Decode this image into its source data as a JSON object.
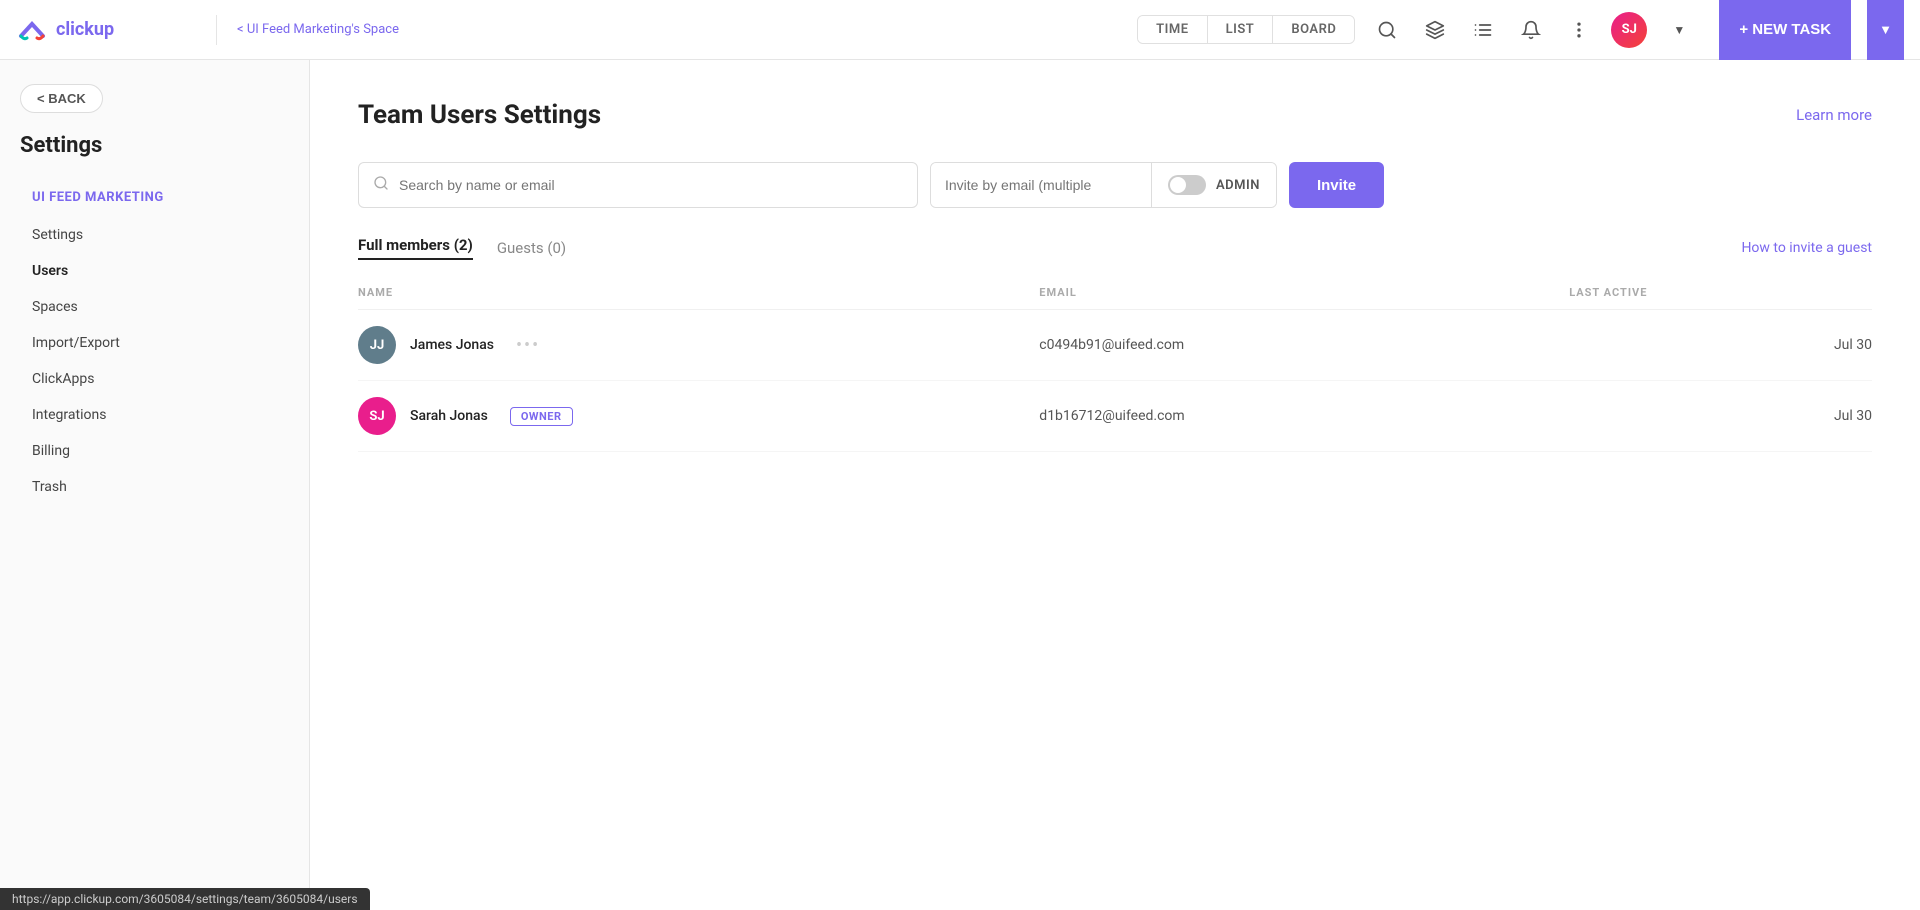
{
  "topnav": {
    "logo_text": "clickup",
    "breadcrumb_back": "< UI Feed Marketing's Space",
    "tabs": [
      {
        "label": "TIME",
        "id": "time"
      },
      {
        "label": "LIST",
        "id": "list"
      },
      {
        "label": "BOARD",
        "id": "board"
      }
    ],
    "new_task_label": "+ NEW TASK",
    "avatar_initials": "SJ"
  },
  "sidebar": {
    "back_label": "< BACK",
    "heading": "Settings",
    "active_item": "UI FEED MARKETING",
    "nav_items": [
      {
        "label": "Settings",
        "id": "settings"
      },
      {
        "label": "Users",
        "id": "users"
      },
      {
        "label": "Spaces",
        "id": "spaces"
      },
      {
        "label": "Import/Export",
        "id": "import-export"
      },
      {
        "label": "ClickApps",
        "id": "clickapps"
      },
      {
        "label": "Integrations",
        "id": "integrations"
      },
      {
        "label": "Billing",
        "id": "billing"
      },
      {
        "label": "Trash",
        "id": "trash"
      }
    ]
  },
  "main": {
    "page_title": "Team Users Settings",
    "learn_more": "Learn more",
    "search_placeholder": "Search by name or email",
    "invite_placeholder": "Invite by email (multiple",
    "admin_label": "ADMIN",
    "invite_button": "Invite",
    "tabs": [
      {
        "label": "Full members (2)",
        "id": "full-members",
        "active": true
      },
      {
        "label": "Guests (0)",
        "id": "guests",
        "active": false
      }
    ],
    "how_to_invite": "How to invite a guest",
    "table_headers": {
      "name": "NAME",
      "email": "EMAIL",
      "last_active": "LAST ACTIVE"
    },
    "members": [
      {
        "id": "james-jonas",
        "initials": "JJ",
        "avatar_class": "avatar-jj",
        "name": "James Jonas",
        "email": "c0494b91@uifeed.com",
        "last_active": "Jul 30",
        "is_owner": false,
        "dots": "•••"
      },
      {
        "id": "sarah-jonas",
        "initials": "SJ",
        "avatar_class": "avatar-sj",
        "name": "Sarah Jonas",
        "email": "d1b16712@uifeed.com",
        "last_active": "Jul 30",
        "is_owner": true,
        "owner_label": "OWNER"
      }
    ]
  },
  "status_bar": {
    "url": "https://app.clickup.com/3605084/settings/team/3605084/users"
  }
}
